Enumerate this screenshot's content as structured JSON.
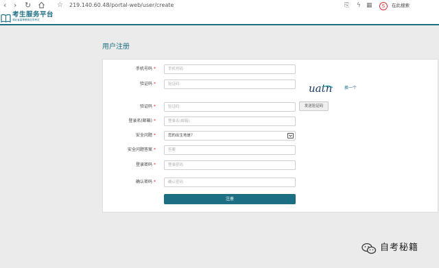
{
  "browser": {
    "url": "219.140.60.48/portal-web/user/create",
    "search_badge": "S",
    "search_label": "在此搜索"
  },
  "site": {
    "title": "考生服务平台",
    "subtitle": "湖北省高等教育自学考试"
  },
  "page": {
    "title": "用户注册"
  },
  "form": {
    "fields": [
      {
        "label": "手机号码",
        "placeholder": "手机号码"
      },
      {
        "label": "验证码",
        "placeholder": "验证码"
      },
      {
        "label": "验证码",
        "placeholder": "验证码"
      },
      {
        "label": "登录名(邮箱)",
        "placeholder": "登录名(邮箱)"
      },
      {
        "label": "安全问题",
        "value": "您的出生地是？"
      },
      {
        "label": "安全问题答案",
        "placeholder": "答案"
      },
      {
        "label": "登录密码",
        "placeholder": "登录密码"
      },
      {
        "label": "确认密码",
        "placeholder": "确认密码"
      }
    ],
    "required_mark": "*",
    "captcha_text": "uatn",
    "refresh_label": "换一个",
    "send_code_label": "发送验证码",
    "submit_label": "注册"
  },
  "watermark": {
    "text": "自考秘籍"
  },
  "colors": {
    "accent": "#1c6e83",
    "required": "#dd2233",
    "background": "#ebebeb"
  }
}
